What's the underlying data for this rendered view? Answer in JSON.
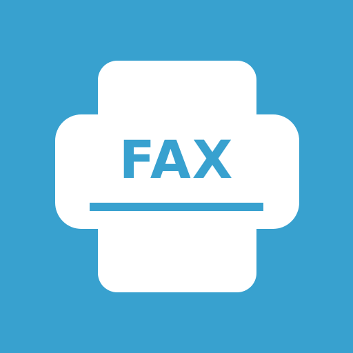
{
  "app_icon": {
    "label": "FAX",
    "icon_name": "fax-machine-icon",
    "colors": {
      "background": "#38a1cf",
      "foreground": "#ffffff"
    }
  }
}
